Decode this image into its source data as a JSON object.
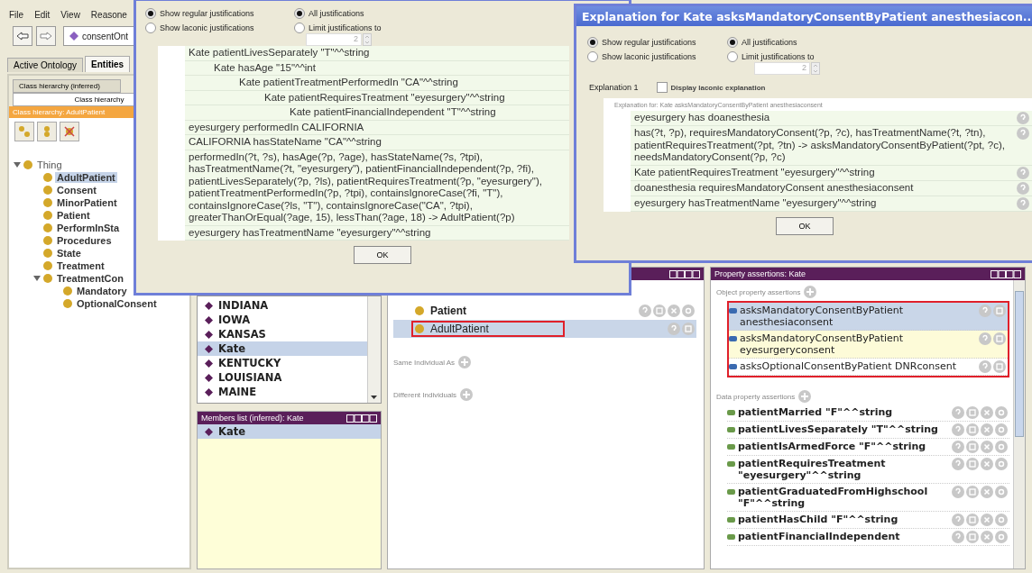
{
  "menu": [
    {
      "label": "File"
    },
    {
      "label": "Edit"
    },
    {
      "label": "View"
    },
    {
      "label": "Reasone"
    }
  ],
  "toolbar": {
    "ontology": "consentOnt"
  },
  "tabs": [
    {
      "label": "Active Ontology",
      "selected": false
    },
    {
      "label": "Entities",
      "selected": true
    }
  ],
  "class_panel": {
    "tabs": [
      {
        "label": "Class hierarchy (inferred)",
        "selected": false
      },
      {
        "label": "Class hierarchy",
        "selected": true
      }
    ],
    "status": "Class hierarchy: AdultPatient",
    "tree": [
      {
        "label": "Thing",
        "selected": false,
        "expanded": true,
        "children": [
          {
            "label": "AdultPatient",
            "selected": true
          },
          {
            "label": "Consent",
            "selected": false
          },
          {
            "label": "MinorPatient",
            "selected": false
          },
          {
            "label": "Patient",
            "selected": false
          },
          {
            "label": "PerformInSta",
            "selected": false
          },
          {
            "label": "Procedures",
            "selected": false
          },
          {
            "label": "State",
            "selected": false
          },
          {
            "label": "Treatment",
            "selected": false
          },
          {
            "label": "TreatmentCon",
            "selected": false,
            "expanded": true,
            "children": [
              {
                "label": "Mandatory",
                "selected": false
              },
              {
                "label": "OptionalConsent",
                "selected": false
              }
            ]
          }
        ]
      }
    ]
  },
  "individuals": [
    {
      "label": "INDIANA",
      "selected": false
    },
    {
      "label": "IOWA",
      "selected": false
    },
    {
      "label": "KANSAS",
      "selected": false
    },
    {
      "label": "Kate",
      "selected": true
    },
    {
      "label": "KENTUCKY",
      "selected": false
    },
    {
      "label": "LOUISIANA",
      "selected": false
    },
    {
      "label": "MAINE",
      "selected": false
    }
  ],
  "members_panel": {
    "title": "Members list (inferred): Kate",
    "items": [
      {
        "label": "Kate",
        "selected": true
      }
    ]
  },
  "types_panel": {
    "types": [
      {
        "label": "Patient",
        "inferred": false,
        "framed": false
      },
      {
        "label": "AdultPatient",
        "inferred": true,
        "framed": true
      }
    ],
    "sections": [
      {
        "label": "Same Individual As"
      },
      {
        "label": "Different Individuals"
      }
    ]
  },
  "property_panel": {
    "title": "Property assertions: Kate",
    "object_section": {
      "label": "Object property assertions",
      "framed": true,
      "rows": [
        {
          "text": "asksMandatoryConsentByPatient anesthesiaconsent",
          "inferred": true,
          "selected": true,
          "highlighted": false
        },
        {
          "text": "asksMandatoryConsentByPatient eyesurgeryconsent",
          "inferred": true,
          "selected": false,
          "highlighted": true
        },
        {
          "text": "asksOptionalConsentByPatient  DNRconsent",
          "inferred": true,
          "selected": false,
          "highlighted": false
        }
      ]
    },
    "data_section": {
      "label": "Data property assertions",
      "rows": [
        {
          "text": "patientMarried  \"F\"^^string",
          "inferred": false
        },
        {
          "text": "patientLivesSeparately \"T\"^^string",
          "inferred": false
        },
        {
          "text": "patientIsArmedForce  \"F\"^^string",
          "inferred": false
        },
        {
          "text": "patientRequiresTreatment \"eyesurgery\"^^string",
          "inferred": false
        },
        {
          "text": "patientGraduatedFromHighschool \"F\"^^string",
          "inferred": false
        },
        {
          "text": "patientHasChild  \"F\"^^string",
          "inferred": false
        },
        {
          "text": "patientFinancialIndependent",
          "inferred": false
        }
      ]
    }
  },
  "dialog_1": {
    "justification_types": [
      {
        "label": "Show regular justifications",
        "selected": true
      },
      {
        "label": "Show laconic justifications",
        "selected": false
      }
    ],
    "justification_limits": [
      {
        "label": "All justifications",
        "selected": true
      },
      {
        "label": "Limit justifications to",
        "selected": false
      }
    ],
    "limit_value": "2",
    "explanation": [
      {
        "text": "Kate patientLivesSeparately \"T\"^^string",
        "children": [
          {
            "text": "Kate hasAge \"15\"^^int",
            "children": [
              {
                "text": "Kate patientTreatmentPerformedIn \"CA\"^^string",
                "children": [
                  {
                    "text": "Kate patientRequiresTreatment \"eyesurgery\"^^string",
                    "children": [
                      {
                        "text": "Kate patientFinancialIndependent \"T\"^^string"
                      }
                    ]
                  }
                ]
              }
            ]
          }
        ]
      },
      {
        "text": "eyesurgery performedIn CALIFORNIA"
      },
      {
        "text": "CALIFORNIA hasStateName \"CA\"^^string"
      },
      {
        "text": "performedIn(?t, ?s), hasAge(?p, ?age), hasStateName(?s, ?tpi), hasTreatmentName(?t, \"eyesurgery\"), patientFinancialIndependent(?p, ?fi), patientLivesSeparately(?p, ?ls), patientRequiresTreatment(?p, \"eyesurgery\"), patientTreatmentPerformedIn(?p, ?tpi), containsIgnoreCase(?fi, \"T\"), containsIgnoreCase(?ls, \"T\"), containsIgnoreCase(\"CA\", ?tpi), greaterThanOrEqual(?age, 15), lessThan(?age, 18) -> AdultPatient(?p)"
      },
      {
        "text": "eyesurgery hasTreatmentName \"eyesurgery\"^^string"
      }
    ],
    "ok": "OK"
  },
  "dialog_2": {
    "title": "Explanation for Kate asksMandatoryConsentByPatient anesthesiacon...",
    "justification_types": [
      {
        "label": "Show regular justifications",
        "selected": true
      },
      {
        "label": "Show laconic justifications",
        "selected": false
      }
    ],
    "justification_limits": [
      {
        "label": "All justifications",
        "selected": true
      },
      {
        "label": "Limit justifications to",
        "selected": false
      }
    ],
    "limit_value": "2",
    "explanation_label": "Explanation 1",
    "laconic_checkbox": {
      "label": "Display laconic explanation",
      "checked": false
    },
    "header": "Explanation for: Kate asksMandatoryConsentByPatient anesthesiaconsent",
    "rows": [
      {
        "text": "eyesurgery has doanesthesia"
      },
      {
        "text": "has(?t, ?p), requiresMandatoryConsent(?p, ?c), hasTreatmentName(?t, ?tn), patientRequiresTreatment(?pt, ?tn) -> asksMandatoryConsentByPatient(?pt, ?c), needsMandatoryConsent(?p, ?c)"
      },
      {
        "text": "Kate patientRequiresTreatment \"eyesurgery\"^^string"
      },
      {
        "text": "doanesthesia requiresMandatoryConsent anesthesiaconsent"
      },
      {
        "text": "eyesurgery hasTreatmentName \"eyesurgery\"^^string"
      }
    ],
    "ok": "OK"
  }
}
